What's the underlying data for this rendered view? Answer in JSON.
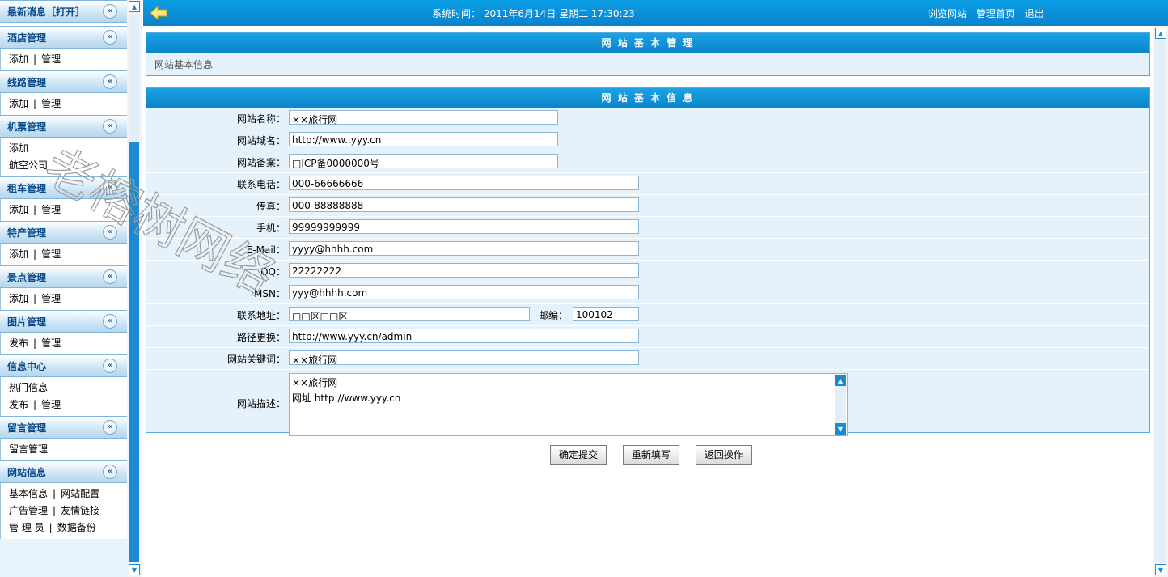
{
  "sidebar": {
    "groups": [
      {
        "title": "最新消息［打开］",
        "lines": []
      },
      {
        "title": "酒店管理",
        "lines": [
          [
            "添加",
            "管理"
          ]
        ]
      },
      {
        "title": "线路管理",
        "lines": [
          [
            "添加",
            "管理"
          ]
        ]
      },
      {
        "title": "机票管理",
        "lines": [
          [
            "添加"
          ],
          [
            "航空公司"
          ]
        ]
      },
      {
        "title": "租车管理",
        "lines": [
          [
            "添加",
            "管理"
          ]
        ]
      },
      {
        "title": "特产管理",
        "lines": [
          [
            "添加",
            "管理"
          ]
        ]
      },
      {
        "title": "景点管理",
        "lines": [
          [
            "添加",
            "管理"
          ]
        ]
      },
      {
        "title": "图片管理",
        "lines": [
          [
            "发布",
            "管理"
          ]
        ]
      },
      {
        "title": "信息中心",
        "lines": [
          [
            "热门信息"
          ],
          [
            "发布",
            "管理"
          ]
        ]
      },
      {
        "title": "留言管理",
        "lines": [
          [
            "留言管理"
          ]
        ]
      },
      {
        "title": "网站信息",
        "lines": [
          [
            "基本信息",
            "网站配置"
          ],
          [
            "广告管理",
            "友情链接"
          ],
          [
            "管 理 员",
            "数据备份"
          ]
        ]
      }
    ],
    "collapse_icon": "double-chevron-left-icon"
  },
  "topbar": {
    "system_time": "系统时间： 2011年6月14日 星期二 17:30:23",
    "links": [
      "浏览网站",
      "管理首页",
      "退出"
    ],
    "back_icon": "back-arrow-icon"
  },
  "panel1": {
    "title": "网 站 基 本 管 理",
    "subtitle": "网站基本信息"
  },
  "panel2": {
    "title": "网 站 基 本 信 息",
    "fields": [
      {
        "label": "网站名称：",
        "value": "××旅行网"
      },
      {
        "label": "网站域名：",
        "value": "http://www..yyy.cn"
      },
      {
        "label": "网站备案：",
        "value": "□ICP备0000000号"
      },
      {
        "label": "联系电话：",
        "value": "000-66666666"
      },
      {
        "label": "传真：",
        "value": "000-88888888"
      },
      {
        "label": "手机：",
        "value": "99999999999"
      },
      {
        "label": "E-Mail：",
        "value": "yyyy@hhhh.com"
      },
      {
        "label": "QQ：",
        "value": "22222222"
      },
      {
        "label": "MSN：",
        "value": "yyy@hhhh.com"
      },
      {
        "label": "联系地址：",
        "value": "□□区□□区"
      },
      {
        "label": "路径更换：",
        "value": "http://www.yyy.cn/admin"
      },
      {
        "label": "网站关键词：",
        "value": "××旅行网"
      }
    ],
    "postcode": {
      "label": "邮编：",
      "value": "100102"
    },
    "description": {
      "label": "网站描述：",
      "line1": "××旅行网",
      "line2": "网址  http://www.yyy.cn"
    }
  },
  "buttons": {
    "submit": "确定提交",
    "reset": "重新填写",
    "back": "返回操作"
  },
  "watermark": "老榕树网络",
  "colors": {
    "accent": "#0a8fd8",
    "header_text": "#0b4a8a",
    "panel_bg": "#e6f2fb"
  }
}
